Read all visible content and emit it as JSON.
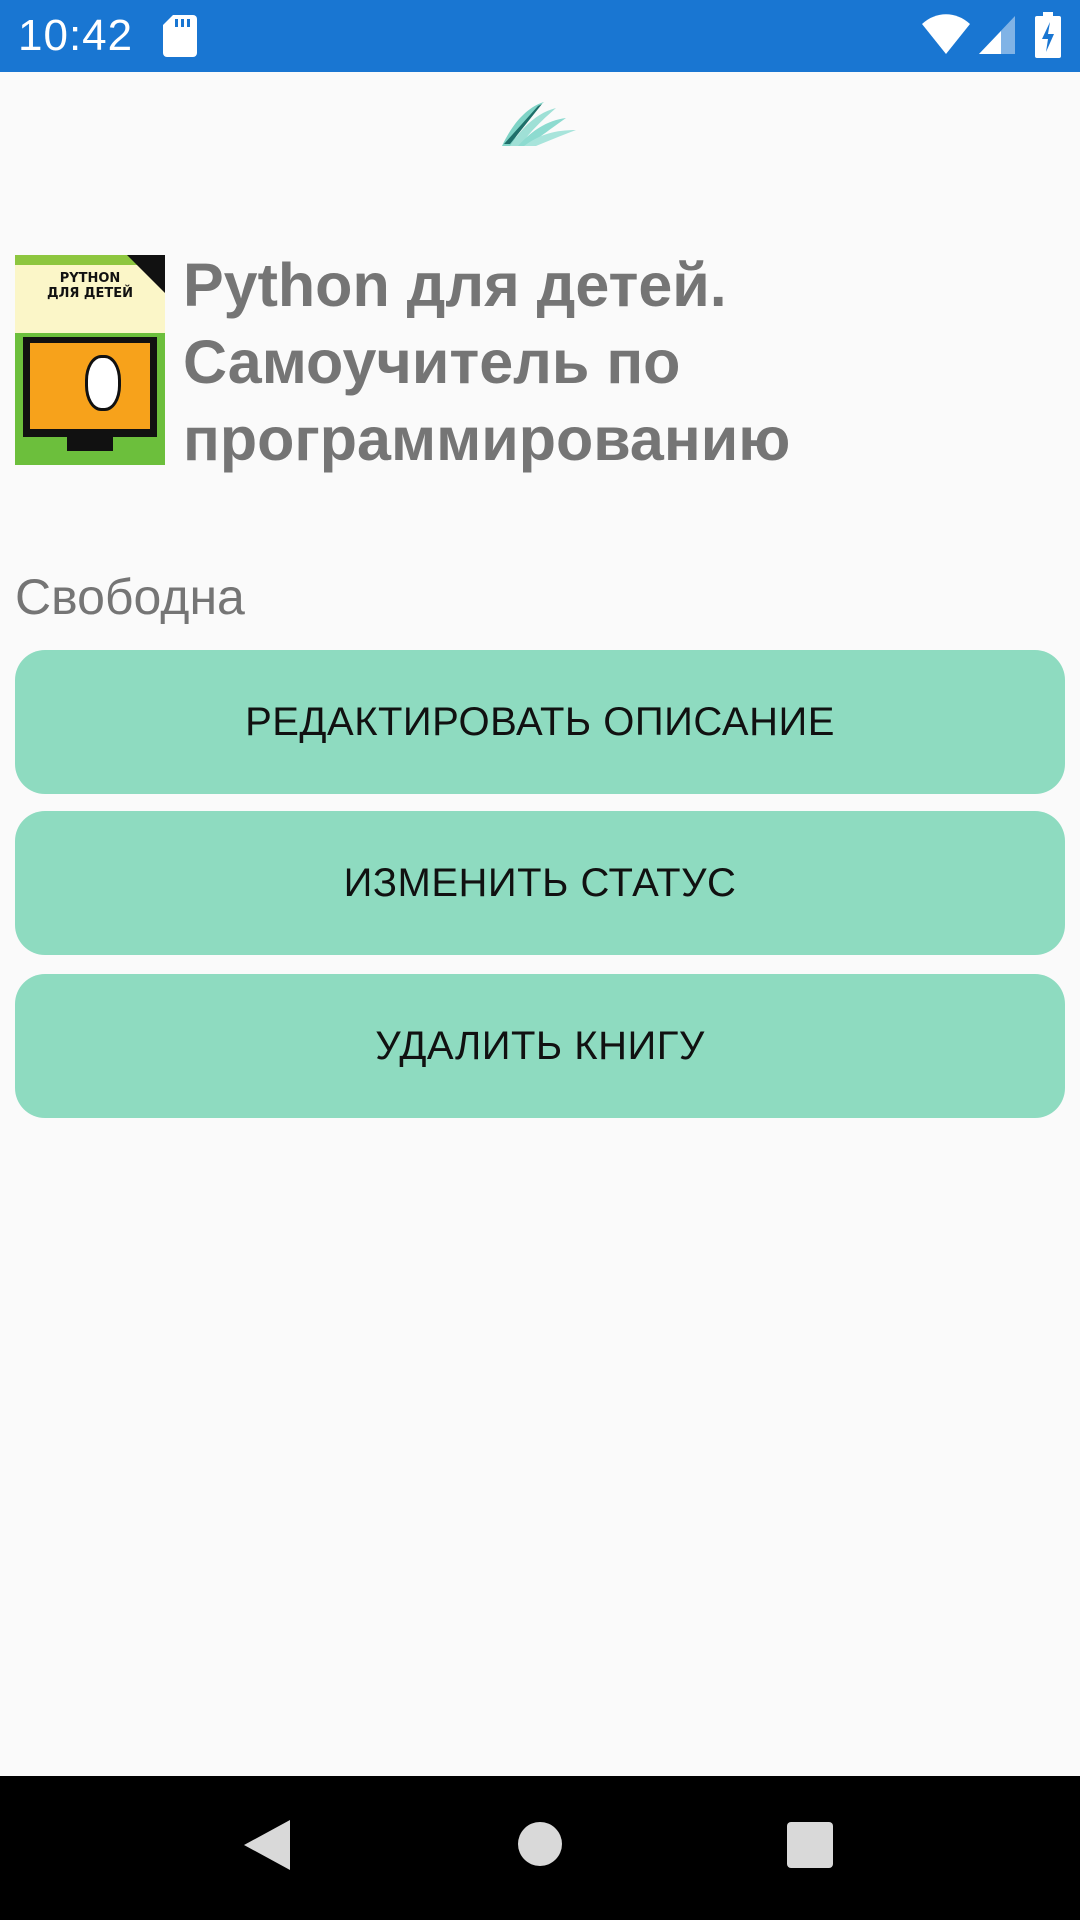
{
  "status_bar": {
    "time": "10:42",
    "icons": [
      "sd-card-icon",
      "wifi-icon",
      "cellular-signal-icon",
      "battery-charging-icon"
    ],
    "background_color": "#1976d2"
  },
  "app": {
    "logo_icon": "book-pages-icon",
    "logo_color": "#8ddbd0"
  },
  "book": {
    "cover_title": "PYTHON\nДЛЯ ДЕТЕЙ",
    "title": "Python для детей. Самоучитель по программированию",
    "status": "Свободна"
  },
  "actions": {
    "edit_label": "РЕДАКТИРОВАТЬ ОПИСАНИЕ",
    "change_status_label": "ИЗМЕНИТЬ СТАТУС",
    "delete_label": "УДАЛИТЬ КНИГУ",
    "button_color": "#8edbc0"
  },
  "navigation_bar": {
    "icons": [
      "back-icon",
      "home-icon",
      "recents-icon"
    ]
  }
}
